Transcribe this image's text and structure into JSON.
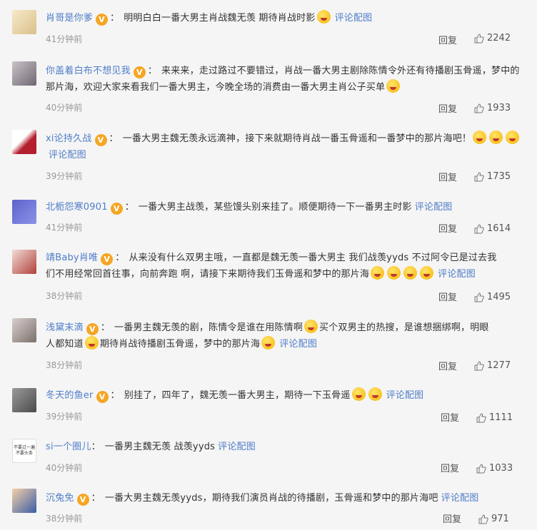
{
  "ui": {
    "reply_label": "回复",
    "pic_link_label": "评论配图",
    "verified_badge": "V"
  },
  "comments": [
    {
      "user": "肖哥是你爹",
      "text": "明明白白一番大男主肖战魏无羡 期待肖战时影",
      "time": "41分钟前",
      "likes": "2242"
    },
    {
      "user": "你盖着白布不想见我",
      "text": "来来来，走过路过不要错过，肖战一番大男主剧除陈情令外还有待播剧玉骨遥，梦中的那片海，欢迎大家来看我们一番大男主，今晚全场的消费由一番大男主肖公子买单",
      "time": "40分钟前",
      "likes": "1933"
    },
    {
      "user": "xi论持久战",
      "text": "一番大男主魏无羡永远滴神，接下来就期待肖战一番玉骨遥和一番梦中的那片海吧！",
      "time": "39分钟前",
      "likes": "1735"
    },
    {
      "user": "北栀怨寒0901",
      "text": "一番大男主战羡，某些馒头别来挂了。顺便期待一下一番男主时影",
      "time": "41分钟前",
      "likes": "1614"
    },
    {
      "user": "靖Baby肖唯",
      "text_a": "从来没有什么双男主哦，一直都是魏无羡一番大男主 我们战羡yyds 不过阿令已是过去我",
      "text_b": "们不用经常回首往事，向前奔跑 啊，请接下来期待我们玉骨遥和梦中的那片海",
      "time": "38分钟前",
      "likes": "1495"
    },
    {
      "user": "浅黛末滴",
      "text_a": "一番男主魏无羡的剧，陈情令是谁在用陈情啊",
      "text_b": "买个双男主的热搜，是谁想捆绑啊，明眼",
      "text_c": "人都知道",
      "text_d": "期待肖战待播剧玉骨遥，梦中的那片海",
      "time": "38分钟前",
      "likes": "1277"
    },
    {
      "user": "冬天的鱼er",
      "text": "别挂了，四年了，魏无羡一番大男主，期待一下玉骨遥",
      "time": "39分钟前",
      "likes": "1111"
    },
    {
      "user": "si一个圈儿",
      "text": "一番男主魏无羡 战羡yyds",
      "time": "40分钟前",
      "likes": "1033",
      "avatar_text": "不要过一遍 不要头条"
    },
    {
      "user": "沉兔免",
      "text": "一番大男主魏无羡yyds，期待我们演员肖战的待播剧，玉骨遥和梦中的那片海吧",
      "time": "38分钟前",
      "likes": "971"
    }
  ]
}
